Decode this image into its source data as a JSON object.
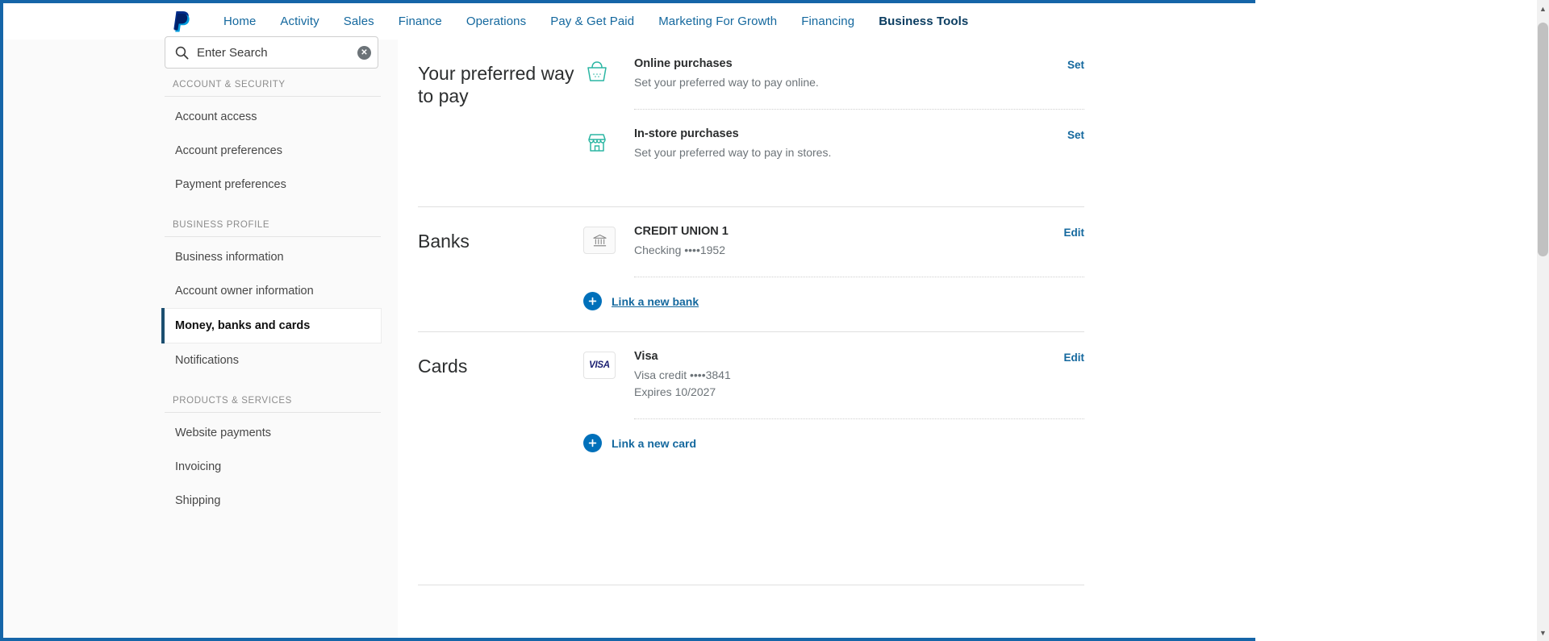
{
  "header": {
    "logo": "paypal-logo",
    "nav": [
      {
        "label": "Home",
        "active": false
      },
      {
        "label": "Activity",
        "active": false
      },
      {
        "label": "Sales",
        "active": false
      },
      {
        "label": "Finance",
        "active": false
      },
      {
        "label": "Operations",
        "active": false
      },
      {
        "label": "Pay & Get Paid",
        "active": false
      },
      {
        "label": "Marketing For Growth",
        "active": false
      },
      {
        "label": "Financing",
        "active": false
      },
      {
        "label": "Business Tools",
        "active": true
      }
    ]
  },
  "search": {
    "placeholder": "Enter Search",
    "value": "",
    "icon": "search-icon",
    "clear_label": "✕"
  },
  "sidebar": {
    "groups": [
      {
        "title": "ACCOUNT & SECURITY",
        "items": [
          {
            "label": "Account access",
            "active": false
          },
          {
            "label": "Account preferences",
            "active": false
          },
          {
            "label": "Payment preferences",
            "active": false
          }
        ]
      },
      {
        "title": "BUSINESS PROFILE",
        "items": [
          {
            "label": "Business information",
            "active": false
          },
          {
            "label": "Account owner information",
            "active": false
          },
          {
            "label": "Money, banks and cards",
            "active": true
          },
          {
            "label": "Notifications",
            "active": false
          }
        ]
      },
      {
        "title": "PRODUCTS & SERVICES",
        "items": [
          {
            "label": "Website payments",
            "active": false
          },
          {
            "label": "Invoicing",
            "active": false
          },
          {
            "label": "Shipping",
            "active": false
          }
        ]
      }
    ]
  },
  "main": {
    "preferred": {
      "title": "Your preferred way to pay",
      "rows": [
        {
          "icon": "shopping-basket-icon",
          "title": "Online purchases",
          "subtitle": "Set your preferred way to pay online.",
          "action": "Set"
        },
        {
          "icon": "storefront-icon",
          "title": "In-store purchases",
          "subtitle": "Set your preferred way to pay in stores.",
          "action": "Set"
        }
      ]
    },
    "banks": {
      "title": "Banks",
      "rows": [
        {
          "icon": "bank-icon",
          "title": "CREDIT UNION 1",
          "subtitle": "Checking ••••1952",
          "action": "Edit"
        }
      ],
      "add_label": "Link a new bank",
      "add_icon": "plus-icon"
    },
    "cards": {
      "title": "Cards",
      "rows": [
        {
          "icon": "visa-logo",
          "icon_text": "VISA",
          "title": "Visa",
          "subtitle": "Visa credit ••••3841",
          "subtitle2": "Expires 10/2027",
          "action": "Edit"
        }
      ],
      "add_label": "Link a new card",
      "add_icon": "plus-icon"
    }
  },
  "colors": {
    "brand_blue": "#14689e",
    "accent_blue": "#0070ba",
    "teal_icon": "#2bb6a3",
    "active_border": "#1c4f70"
  }
}
